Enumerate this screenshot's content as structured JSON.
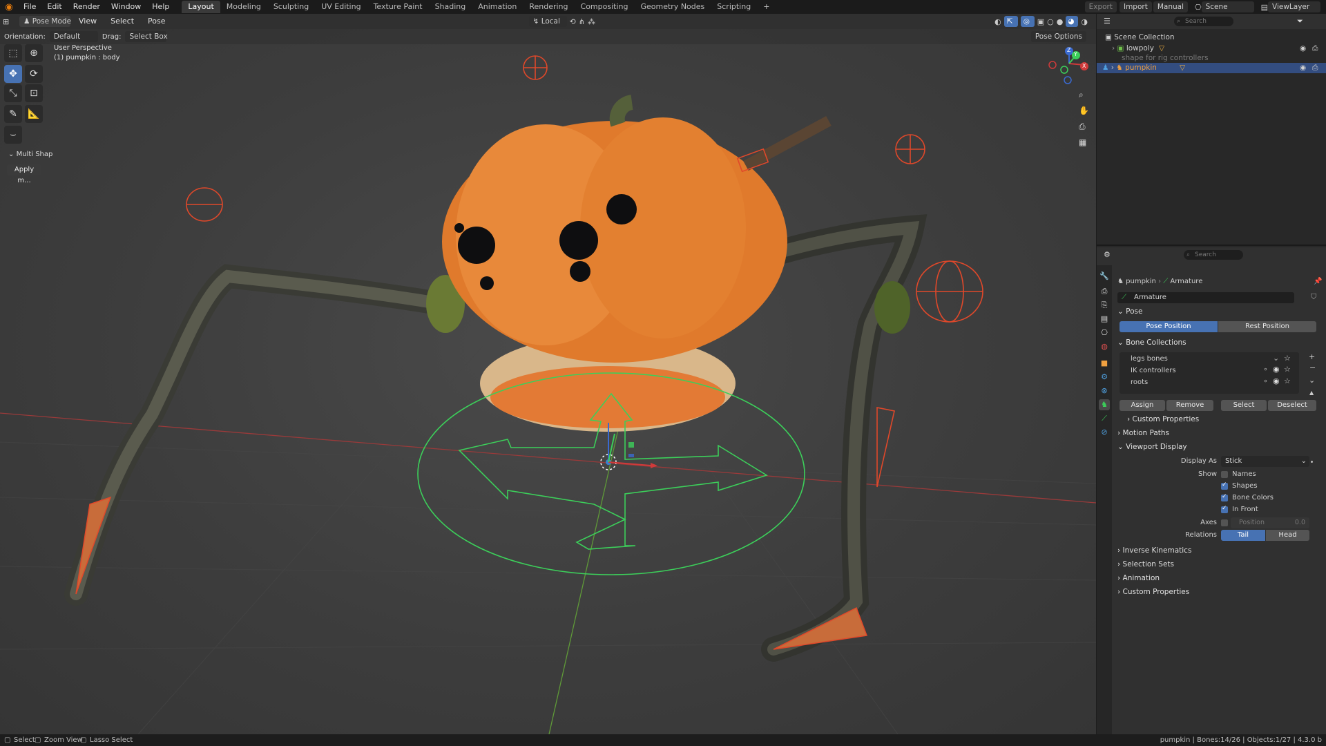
{
  "topbar": {
    "menus": [
      "File",
      "Edit",
      "Render",
      "Window",
      "Help"
    ],
    "workspaces": [
      "Layout",
      "Modeling",
      "Sculpting",
      "UV Editing",
      "Texture Paint",
      "Shading",
      "Animation",
      "Rendering",
      "Compositing",
      "Geometry Nodes",
      "Scripting"
    ],
    "add_tab": "+",
    "export": "Export",
    "import": "Import",
    "manual": "Manual",
    "scene": "Scene",
    "view_layer": "ViewLayer"
  },
  "viewport_header": {
    "mode": "Pose Mode",
    "menus": [
      "View",
      "Select",
      "Pose"
    ],
    "transform_orientation": "Local"
  },
  "tool_settings": {
    "orientation_label": "Orientation:",
    "orientation_value": "Default",
    "drag_label": "Drag:",
    "drag_value": "Select Box",
    "pose_options": "Pose Options"
  },
  "viewport": {
    "perspective": "User Perspective",
    "active_object": "(1) pumpkin : body",
    "panel_header": "Multi Shap",
    "panel_button": "Apply m...",
    "gizmo_axes": {
      "x": "X",
      "y": "Y",
      "z": "Z"
    },
    "nav_icons": [
      "zoom-icon",
      "pan-hand-icon",
      "camera-icon",
      "grid-icon"
    ]
  },
  "outliner": {
    "search_placeholder": "Search",
    "root": "Scene Collection",
    "items": [
      {
        "name": "lowpoly",
        "selected": false,
        "dim": false
      },
      {
        "name": "shape for rig controllers",
        "selected": false,
        "dim": true
      },
      {
        "name": "pumpkin",
        "selected": true,
        "dim": false
      }
    ]
  },
  "properties": {
    "search_placeholder": "Search",
    "breadcrumb_object": "pumpkin",
    "breadcrumb_data": "Armature",
    "data_name": "Armature",
    "pose_panel": {
      "title": "Pose",
      "pose_position": "Pose Position",
      "rest_position": "Rest Position"
    },
    "bone_collections": {
      "title": "Bone Collections",
      "items": [
        "legs bones",
        "IK controllers",
        "roots"
      ],
      "assign": "Assign",
      "remove": "Remove",
      "select": "Select",
      "deselect": "Deselect",
      "custom_properties": "Custom Properties"
    },
    "motion_paths": "Motion Paths",
    "viewport_display": {
      "title": "Viewport Display",
      "display_as_label": "Display As",
      "display_as_value": "Stick",
      "show_label": "Show",
      "names": "Names",
      "shapes": "Shapes",
      "bone_colors": "Bone Colors",
      "in_front": "In Front",
      "axes_label": "Axes",
      "axes_position": "Position",
      "axes_value": "0.0",
      "relations_label": "Relations",
      "tail": "Tail",
      "head": "Head"
    },
    "inverse_kinematics": "Inverse Kinematics",
    "selection_sets": "Selection Sets",
    "animation": "Animation",
    "custom_properties": "Custom Properties"
  },
  "statusbar": {
    "select": "Select",
    "zoom_view": "Zoom View",
    "lasso_select": "Lasso Select",
    "stats": "pumpkin | Bones:14/26 | Objects:1/27 | 4.3.0 b"
  },
  "colors": {
    "accent": "#4772b3",
    "pumpkin": "#e07a2c",
    "bone_orange": "#e0482a",
    "gizmo_green": "#3ccf5a"
  }
}
